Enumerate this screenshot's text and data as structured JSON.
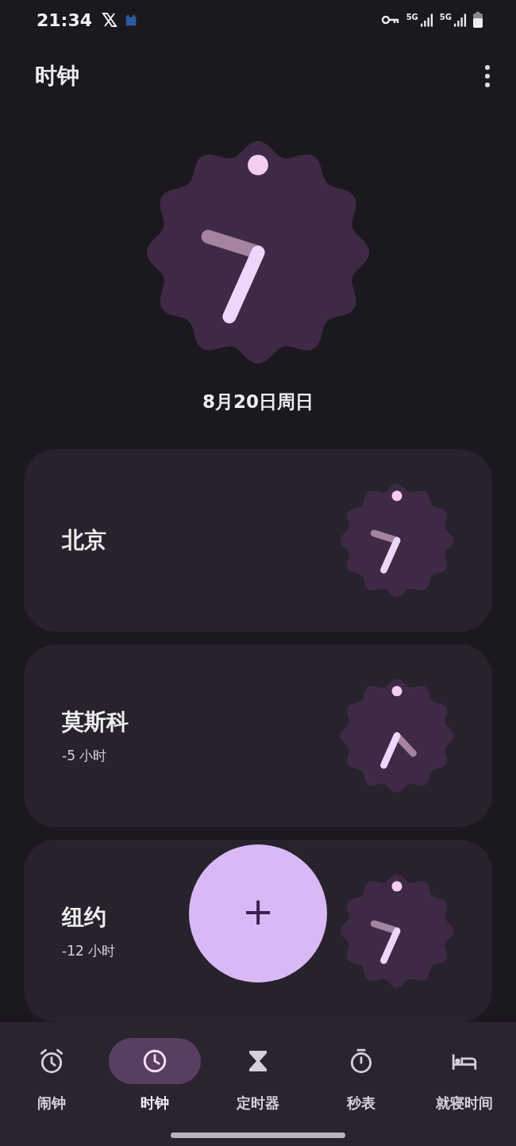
{
  "status_bar": {
    "time": "21:34",
    "net_1": "5G",
    "net_2": "5G"
  },
  "app_bar": {
    "title": "时钟"
  },
  "main_clock": {
    "date": "8月20日周日"
  },
  "cities": [
    {
      "name": "北京"
    },
    {
      "name": "莫斯科",
      "offset": "-5 小时"
    },
    {
      "name": "纽约",
      "offset": "-12 小时"
    }
  ],
  "fab": {
    "label": "+"
  },
  "tabs": [
    {
      "kind": "alarm",
      "label": "闹钟",
      "selected": false
    },
    {
      "kind": "clock",
      "label": "时钟",
      "selected": true
    },
    {
      "kind": "timer",
      "label": "定时器",
      "selected": false
    },
    {
      "kind": "stopwatch",
      "label": "秒表",
      "selected": false
    },
    {
      "kind": "bedtime",
      "label": "就寝时间",
      "selected": false
    }
  ]
}
